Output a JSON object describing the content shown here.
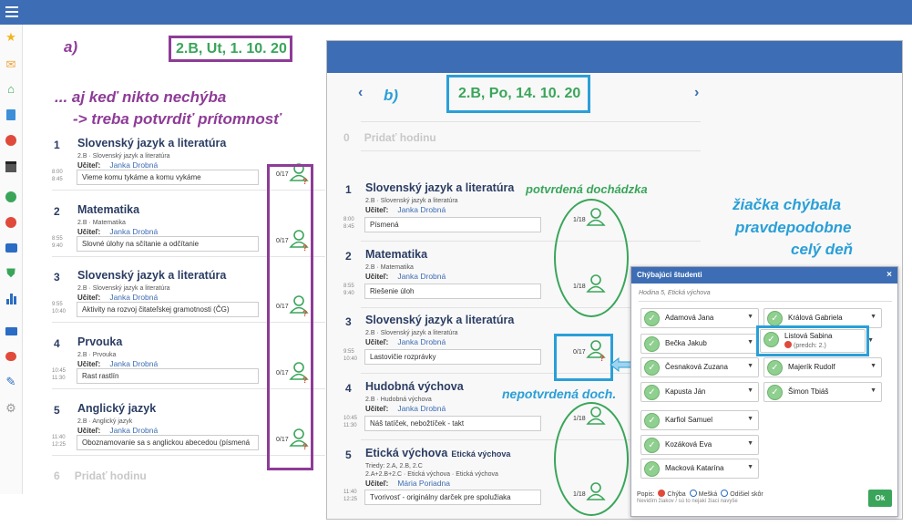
{
  "panel_a": {
    "label": "a)",
    "date": "2.B, Ut, 1. 10. 20",
    "note_line1": "... aj keď nikto nechýba",
    "note_line2": "-> treba potvrdiť prítomnosť",
    "add_lesson_num": "6",
    "add_lesson_label": "Pridať hodinu",
    "lessons": [
      {
        "num": "1",
        "title": "Slovenský jazyk a literatúra",
        "sub": "2.B · Slovenský jazyk a literatúra",
        "teacher_label": "Učiteľ:",
        "teacher": "Janka Drobná",
        "time_from": "8:00",
        "time_to": "8:45",
        "topic": "Vieme komu tykáme a komu vykáme",
        "count": "0/17"
      },
      {
        "num": "2",
        "title": "Matematika",
        "sub": "2.B · Matematika",
        "teacher_label": "Učiteľ:",
        "teacher": "Janka Drobná",
        "time_from": "8:55",
        "time_to": "9:40",
        "topic": "Slovné úlohy na sčítanie a odčítanie",
        "count": "0/17"
      },
      {
        "num": "3",
        "title": "Slovenský jazyk a literatúra",
        "sub": "2.B · Slovenský jazyk a literatúra",
        "teacher_label": "Učiteľ:",
        "teacher": "Janka Drobná",
        "time_from": "9:55",
        "time_to": "10:40",
        "topic": "Aktivity na rozvoj čitateľskej gramotnosti (ČG)",
        "count": "0/17"
      },
      {
        "num": "4",
        "title": "Prvouka",
        "sub": "2.B · Prvouka",
        "teacher_label": "Učiteľ:",
        "teacher": "Janka Drobná",
        "time_from": "10:45",
        "time_to": "11:30",
        "topic": "Rast rastlín",
        "count": "0/17"
      },
      {
        "num": "5",
        "title": "Anglický jazyk",
        "sub": "2.B · Anglický jazyk",
        "teacher_label": "Učiteľ:",
        "teacher": "Janka Drobná",
        "time_from": "11:40",
        "time_to": "12:25",
        "topic": "Oboznamovanie sa s anglickou abecedou (písmená",
        "count": "0/17"
      }
    ]
  },
  "panel_b": {
    "label": "b)",
    "date": "2.B, Po, 14. 10. 20",
    "prev": "‹",
    "next": "›",
    "add_lesson_num": "0",
    "add_lesson_label": "Pridať hodinu",
    "lessons": [
      {
        "num": "1",
        "title": "Slovenský jazyk a literatúra",
        "title_extra": "",
        "sub": "2.B · Slovenský jazyk a literatúra",
        "teacher_label": "Učiteľ:",
        "teacher": "Janka Drobná",
        "time_from": "8:00",
        "time_to": "8:45",
        "topic": "Písmená",
        "count": "1/18"
      },
      {
        "num": "2",
        "title": "Matematika",
        "title_extra": "",
        "sub": "2.B · Matematika",
        "teacher_label": "Učiteľ:",
        "teacher": "Janka Drobná",
        "time_from": "8:55",
        "time_to": "9:40",
        "topic": "Riešenie úloh",
        "count": "1/18"
      },
      {
        "num": "3",
        "title": "Slovenský jazyk a literatúra",
        "title_extra": "",
        "sub": "2.B · Slovenský jazyk a literatúra",
        "teacher_label": "Učiteľ:",
        "teacher": "Janka Drobná",
        "time_from": "9:55",
        "time_to": "10:40",
        "topic": "Lastovičie rozprávky",
        "count": "0/17"
      },
      {
        "num": "4",
        "title": "Hudobná výchova",
        "title_extra": "",
        "sub": "2.B · Hudobná výchova",
        "teacher_label": "Učiteľ:",
        "teacher": "Janka Drobná",
        "time_from": "10:45",
        "time_to": "11:30",
        "topic": "Náš tatíček, nebožtíček - takt",
        "count": "1/18"
      },
      {
        "num": "5",
        "title": "Etická výchova",
        "title_extra": "Etická výchova",
        "sub": "Triedy: 2.A, 2.B, 2.C",
        "sub2": "2.A+2.B+2.C · Etická výchova · Etická výchova",
        "teacher_label": "Učiteľ:",
        "teacher": "Mária Poriadna",
        "time_from": "11:40",
        "time_to": "12:25",
        "topic": "Tvorivosť - originálny darček pre spolužiaka",
        "count": "1/18"
      }
    ]
  },
  "annotations": {
    "confirmed": "potvrdená dochádzka",
    "unconfirmed": "nepotvrdená doch.",
    "absent_line1": "žiačka chýbala",
    "absent_line2": "pravdepodobne",
    "absent_line3": "celý deň"
  },
  "modal": {
    "title": "Chýbajúci študenti",
    "close": "×",
    "subtitle": "Hodina 5, Etická výchova",
    "students_left": [
      "Adamová Jana",
      "Bečka Jakub",
      "Česnaková Zuzana",
      "Kapusta Ján",
      "Karfiol Samuel",
      "Kozáková Eva",
      "Macková Katarína"
    ],
    "students_right": [
      "Králová Gabriela",
      "Listová Sabina",
      "Majerík Rudolf",
      "Šimon Tbiáš"
    ],
    "absent_note": "(predch: 2.)",
    "legend_label": "Popis:",
    "legend_absent": "Chýba",
    "legend_late": "Mešká",
    "legend_left": "Odišiel skôr",
    "legend_note": "Nevidím žiakov / sú to nejakí žiaci navyše",
    "ok": "Ok"
  },
  "colors": {
    "accent_blue": "#3d6db4",
    "annotation_purple": "#8e3c97",
    "annotation_blue": "#2a9fd8",
    "confirmed_green": "#3aa55a"
  }
}
